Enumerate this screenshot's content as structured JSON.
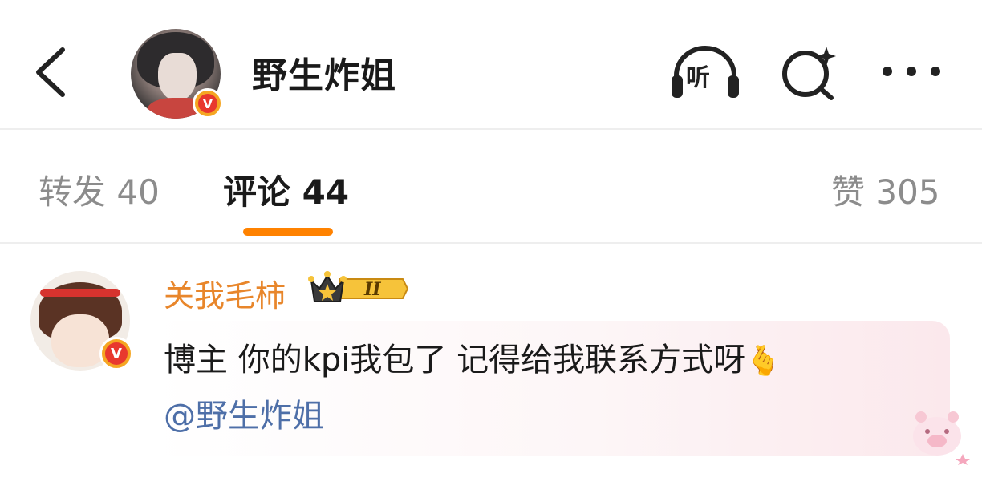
{
  "header": {
    "title": "野生炸姐",
    "listen_label": "听",
    "verified_mark": "V",
    "icons": [
      "back-arrow-icon",
      "listen-headphones-icon",
      "search-sparkle-icon",
      "more-dots-icon"
    ]
  },
  "tabs": {
    "repost": "转发 40",
    "comments": "评论 44",
    "likes": "赞 305",
    "active": "comments",
    "accent_color": "#ff8200"
  },
  "comment": {
    "username": "关我毛柿",
    "verified_mark": "V",
    "vip_level": "II",
    "text": "博主 你的kpi我包了 记得给我联系方式呀",
    "emoji": "🫰",
    "mention": "@野生炸姐",
    "username_color": "#e8862b",
    "mention_color": "#4e6fa8"
  }
}
